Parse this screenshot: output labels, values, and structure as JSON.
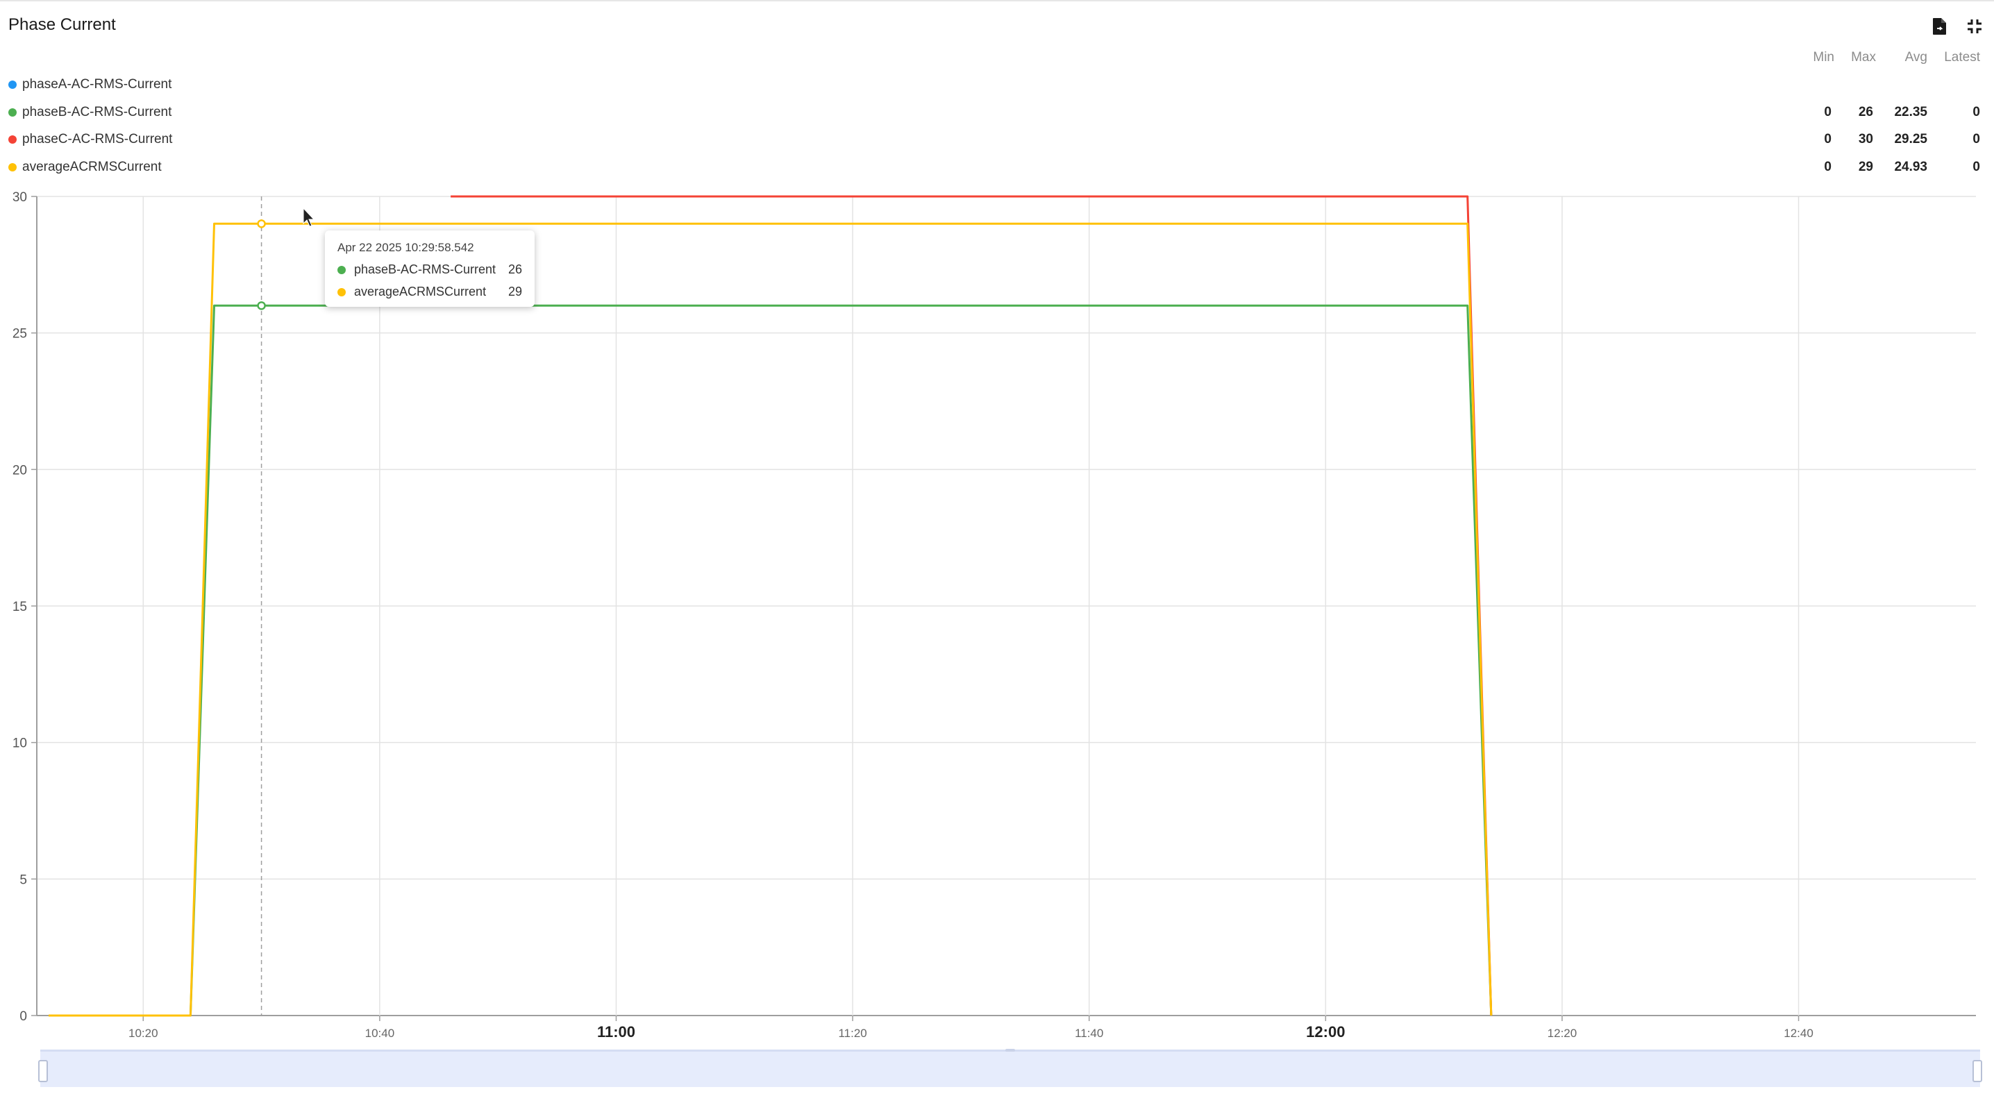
{
  "title": "Phase Current",
  "icons": {
    "export": "file-export-icon",
    "collapse": "fullscreen-exit-icon"
  },
  "stats_headers": {
    "min": "Min",
    "max": "Max",
    "avg": "Avg",
    "latest": "Latest"
  },
  "legend": [
    {
      "name": "phaseA-AC-RMS-Current",
      "color": "#2196f3",
      "min": "",
      "max": "",
      "avg": "",
      "latest": ""
    },
    {
      "name": "phaseB-AC-RMS-Current",
      "color": "#4caf50",
      "min": "0",
      "max": "26",
      "avg": "22.35",
      "latest": "0"
    },
    {
      "name": "phaseC-AC-RMS-Current",
      "color": "#f44336",
      "min": "0",
      "max": "30",
      "avg": "29.25",
      "latest": "0"
    },
    {
      "name": "averageACRMSCurrent",
      "color": "#ffc107",
      "min": "0",
      "max": "29",
      "avg": "24.93",
      "latest": "0"
    }
  ],
  "tooltip": {
    "time": "Apr 22 2025 10:29:58.542",
    "rows": [
      {
        "name": "phaseB-AC-RMS-Current",
        "value": "26",
        "color": "#4caf50"
      },
      {
        "name": "averageACRMSCurrent",
        "value": "29",
        "color": "#ffc107"
      }
    ]
  },
  "chart_data": {
    "type": "line",
    "title": "Phase Current",
    "ylim": [
      0,
      30
    ],
    "xlim": [
      "10:11",
      "12:55"
    ],
    "x_ticks": [
      "10:20",
      "10:40",
      "11:00",
      "11:20",
      "11:40",
      "12:00",
      "12:20",
      "12:40"
    ],
    "x_ticks_bold": [
      "11:00",
      "12:00"
    ],
    "y_ticks": [
      0,
      5,
      10,
      15,
      20,
      25,
      30
    ],
    "grid": true,
    "series": [
      {
        "name": "phaseB-AC-RMS-Current",
        "color": "#4caf50",
        "points": [
          [
            "10:12",
            0
          ],
          [
            "10:24",
            0
          ],
          [
            "10:26",
            26
          ],
          [
            "12:12",
            26
          ],
          [
            "12:14",
            0
          ]
        ]
      },
      {
        "name": "phaseC-AC-RMS-Current",
        "color": "#f44336",
        "points": [
          [
            "10:46",
            30
          ],
          [
            "12:12",
            30
          ],
          [
            "12:14",
            0
          ]
        ]
      },
      {
        "name": "averageACRMSCurrent",
        "color": "#ffc107",
        "points": [
          [
            "10:12",
            0
          ],
          [
            "10:24",
            0
          ],
          [
            "10:26",
            29
          ],
          [
            "12:12",
            29
          ],
          [
            "12:14",
            0
          ]
        ]
      }
    ],
    "hover_x": "10:30"
  }
}
